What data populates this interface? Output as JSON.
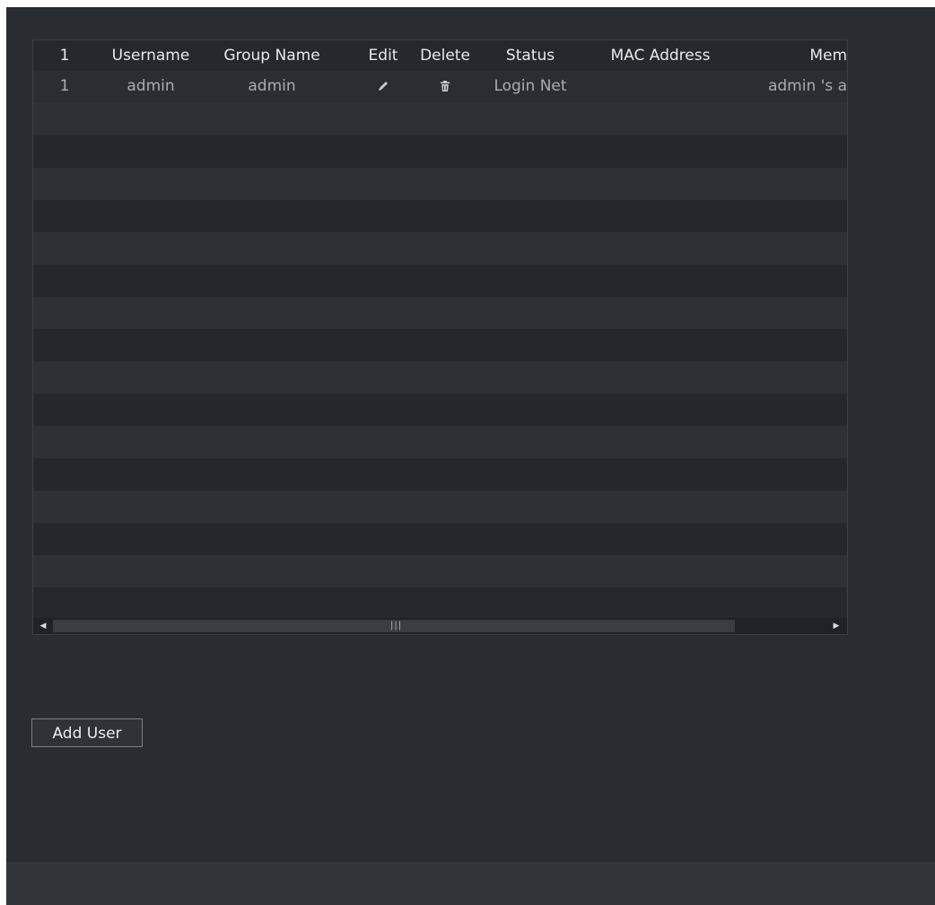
{
  "table": {
    "columns": [
      "1",
      "Username",
      "Group Name",
      "Edit",
      "Delete",
      "Status",
      "MAC Address",
      "Mem"
    ],
    "rows": [
      {
        "index": "1",
        "username": "admin",
        "group_name": "admin",
        "edit_icon": "pencil-icon",
        "delete_icon": "trash-icon",
        "status": "Login Net",
        "mac_address": "",
        "memo": "admin 's a"
      }
    ],
    "empty_rows": 15
  },
  "scrollbar": {
    "left_arrow": "◀",
    "right_arrow": "▶",
    "grip": "|||"
  },
  "actions": {
    "add_user_label": "Add User"
  },
  "colors": {
    "background": "#292c31",
    "table_bg": "#25282c",
    "row_alt": "#2d3035",
    "header_text": "#e8e9eb",
    "row_text": "#a9adb3"
  }
}
